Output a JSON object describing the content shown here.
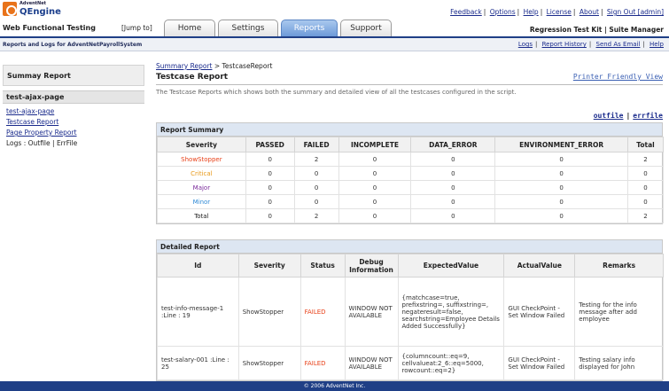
{
  "brand": {
    "company": "AdventNet",
    "product": "QEngine",
    "colors": {
      "accent": "#1f3f86",
      "tab_active": "#6d9ad8",
      "failed": "#e8421a"
    }
  },
  "header": {
    "product_line": "Web Functional Testing",
    "jump_to": "[Jump to]",
    "links": [
      "Feedback",
      "Options",
      "Help",
      "License",
      "About",
      "Sign Out [admin]"
    ],
    "suite_label": "Regression Test Kit | Suite Manager"
  },
  "tabs": [
    {
      "label": "Home"
    },
    {
      "label": "Settings"
    },
    {
      "label": "Reports"
    },
    {
      "label": "Support"
    }
  ],
  "subbar": {
    "title": "Reports and Logs for AdventNetPayrollSystem",
    "links": [
      "Logs",
      "Report History",
      "Send As Email",
      "Help"
    ]
  },
  "sidebar": {
    "heading": "Summay Report",
    "section": "test-ajax-page",
    "links": [
      "test-ajax-page",
      "Testcase Report",
      "Page Property Report"
    ],
    "logs_label": "Logs :",
    "logs_links": [
      "Outfile",
      "ErrFile"
    ]
  },
  "main": {
    "breadcrumb_link": "Summary Report",
    "breadcrumb_current": "> TestcaseReport",
    "title": "Testcase Report",
    "printer_link": "Printer Friendly View",
    "description": "The Testcase Reports which shows both the summary and detailed view of all the testcases configured in the script.",
    "outfile": "outfile",
    "errfile": "errfile"
  },
  "summary": {
    "title": "Report Summary",
    "columns": [
      "Severity",
      "PASSED",
      "FAILED",
      "INCOMPLETE",
      "DATA_ERROR",
      "ENVIRONMENT_ERROR",
      "Total"
    ],
    "rows": [
      {
        "severity": "ShowStopper",
        "passed": "0",
        "failed": "2",
        "incomplete": "0",
        "data_error": "0",
        "env_error": "0",
        "total": "2"
      },
      {
        "severity": "Critical",
        "passed": "0",
        "failed": "0",
        "incomplete": "0",
        "data_error": "0",
        "env_error": "0",
        "total": "0"
      },
      {
        "severity": "Major",
        "passed": "0",
        "failed": "0",
        "incomplete": "0",
        "data_error": "0",
        "env_error": "0",
        "total": "0"
      },
      {
        "severity": "Minor",
        "passed": "0",
        "failed": "0",
        "incomplete": "0",
        "data_error": "0",
        "env_error": "0",
        "total": "0"
      },
      {
        "severity": "Total",
        "passed": "0",
        "failed": "2",
        "incomplete": "0",
        "data_error": "0",
        "env_error": "0",
        "total": "2"
      }
    ]
  },
  "detailed": {
    "title": "Detailed Report",
    "columns": [
      "Id",
      "Severity",
      "Status",
      "Debug Information",
      "ExpectedValue",
      "ActualValue",
      "Remarks"
    ],
    "rows": [
      {
        "id": "test-info-message-1 :Line : 19",
        "severity": "ShowStopper",
        "status": "FAILED",
        "debug": "WINDOW NOT AVAILABLE",
        "expected": "{matchcase=true, prefixstring=, suffixstring=, negateresult=false, searchstring=Employee Details Added Successfully}",
        "actual": "GUI CheckPoint - Set Window Failed",
        "remarks": "Testing for the info message after add employee"
      },
      {
        "id": "test-salary-001 :Line : 25",
        "severity": "ShowStopper",
        "status": "FAILED",
        "debug": "WINDOW NOT AVAILABLE",
        "expected": "{columncount::eq=9, cellvalueat:2_6::eq=5000, rowcount::eq=2}",
        "actual": "GUI CheckPoint - Set Window Failed",
        "remarks": "Testing salary info displayed for John"
      }
    ]
  },
  "footer": {
    "text": "© 2006 AdventNet Inc."
  }
}
